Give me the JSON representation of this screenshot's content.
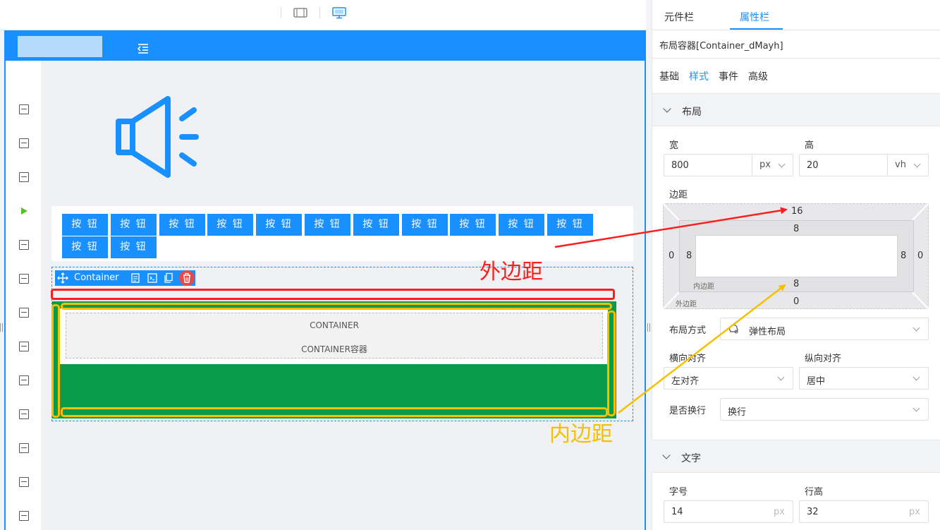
{
  "toolbar": {
    "devices": [
      "tablet-icon",
      "desktop-icon"
    ],
    "active_device": "desktop-icon"
  },
  "canvas": {
    "buttons": [
      "按 钮",
      "按 钮",
      "按 钮",
      "按 钮",
      "按 钮",
      "按 钮",
      "按 钮",
      "按 钮",
      "按 钮",
      "按 钮",
      "按 钮",
      "按 钮",
      "按 钮"
    ],
    "container_toolbar_label": "Container",
    "inner_line1": "CONTAINER",
    "inner_line2": "CONTAINER容器",
    "annotation_outer": "外边距",
    "annotation_inner": "内边距",
    "accent": "#1890ff",
    "green": "#0a9b48"
  },
  "panel": {
    "tabs": [
      "元件栏",
      "属性栏"
    ],
    "active_tab": "属性栏",
    "component_name": "布局容器[Container_dMayh]",
    "subtabs": [
      "基础",
      "样式",
      "事件",
      "高级"
    ],
    "active_subtab": "样式",
    "layout": {
      "title": "布局",
      "width_label": "宽",
      "width_value": "800",
      "width_unit": "px",
      "height_label": "高",
      "height_value": "20",
      "height_unit": "vh",
      "spacing_label": "边距",
      "margin": {
        "top": "16",
        "right": "0",
        "bottom": "0",
        "left": "0",
        "caption": "外边距"
      },
      "padding": {
        "top": "8",
        "right": "8",
        "bottom": "8",
        "left": "8",
        "caption": "内边距"
      },
      "layout_mode_label": "布局方式",
      "layout_mode_value": "弹性布局",
      "h_align_label": "横向对齐",
      "h_align_value": "左对齐",
      "v_align_label": "纵向对齐",
      "v_align_value": "居中",
      "wrap_label": "是否换行",
      "wrap_value": "换行"
    },
    "text": {
      "title": "文字",
      "font_size_label": "字号",
      "font_size_value": "14",
      "font_size_unit": "px",
      "line_height_label": "行高",
      "line_height_value": "32",
      "line_height_unit": "px"
    }
  }
}
